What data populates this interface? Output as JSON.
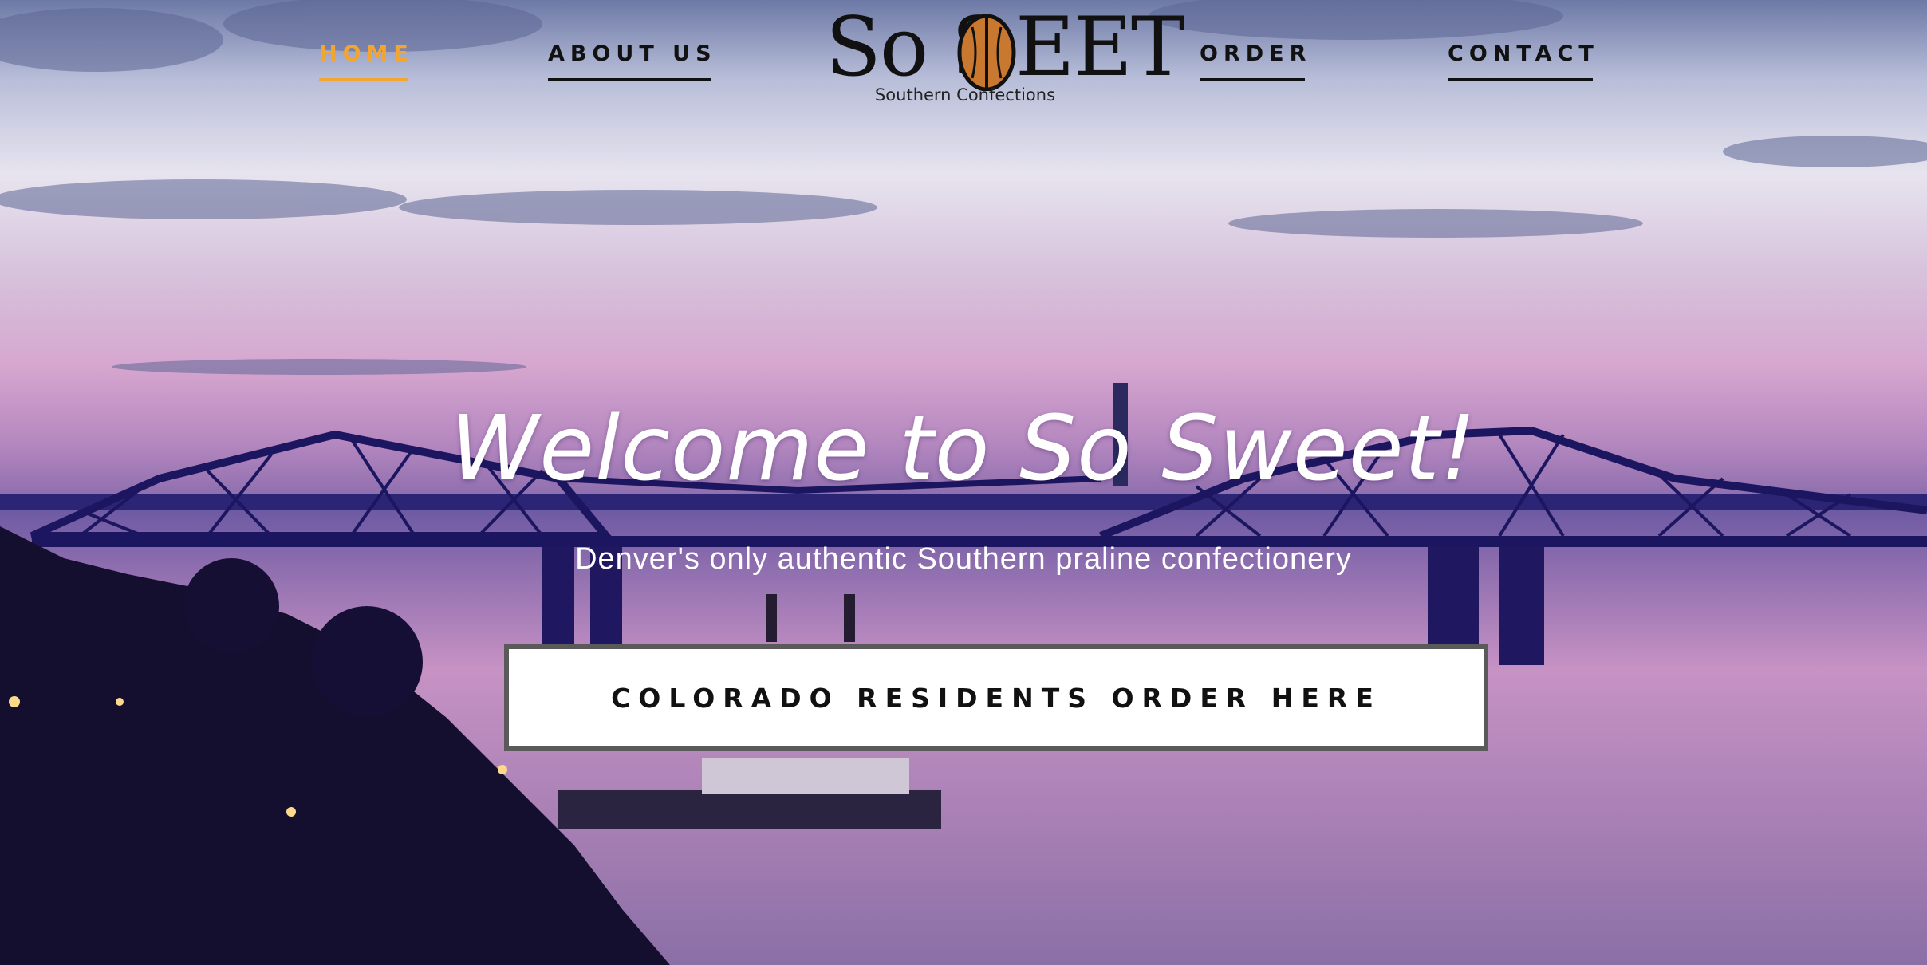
{
  "nav": {
    "items": [
      {
        "label": "HOME",
        "active": true
      },
      {
        "label": "ABOUT US",
        "active": false
      },
      {
        "label": "ORDER",
        "active": false
      },
      {
        "label": "CONTACT",
        "active": false
      }
    ],
    "active_color": "#f2a531"
  },
  "logo": {
    "word_left": "So S",
    "word_right": "EET",
    "icon": "pecan-icon",
    "tagline": "Southern Confections"
  },
  "hero": {
    "title": "Welcome to So Sweet!",
    "subtitle": "Denver's only authentic Southern praline confectionery",
    "cta_label": "COLORADO RESIDENTS ORDER HERE",
    "background": "dusk-river-bridge-photo"
  }
}
